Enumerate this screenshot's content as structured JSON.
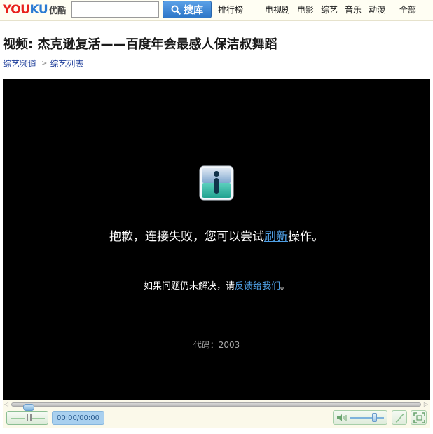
{
  "header": {
    "logo_text_you": "YOU",
    "logo_text_ku": "KU",
    "logo_text_cn": "优酷",
    "search": {
      "value": "",
      "placeholder": ""
    },
    "search_button_label": "搜库",
    "nav": {
      "ranking": "排行榜",
      "tv": "电视剧",
      "movie": "电影",
      "variety": "综艺",
      "music": "音乐",
      "anime": "动漫",
      "all": "全部"
    }
  },
  "page": {
    "title": "视频: 杰克逊复活——百度年会最感人保洁叔舞蹈",
    "breadcrumb": {
      "first": "综艺频道",
      "separator": ">",
      "second": "综艺列表"
    }
  },
  "player": {
    "error_main_before": "抱歉，连接失败，您可以尝试",
    "error_main_link": "刷新",
    "error_main_after": "操作。",
    "error_sub_before": "如果问题仍未解决，请",
    "error_sub_link": "反馈给我们",
    "error_sub_after": "。",
    "error_code": "代码：2003",
    "time": "00:00/00:00",
    "seek_arrow_left": "◁",
    "seek_arrow_right": "▷",
    "progress": 0,
    "volume_level": 0.7
  },
  "colors": {
    "accent_blue": "#2e77c8",
    "link_blue": "#4f9fe4",
    "player_bg": "#000000",
    "logo_red": "#e8211c"
  },
  "icons": {
    "info": "info-icon",
    "search": "search-icon",
    "speaker": "speaker-icon",
    "light": "light-curve-icon",
    "fullscreen": "fullscreen-icon"
  }
}
